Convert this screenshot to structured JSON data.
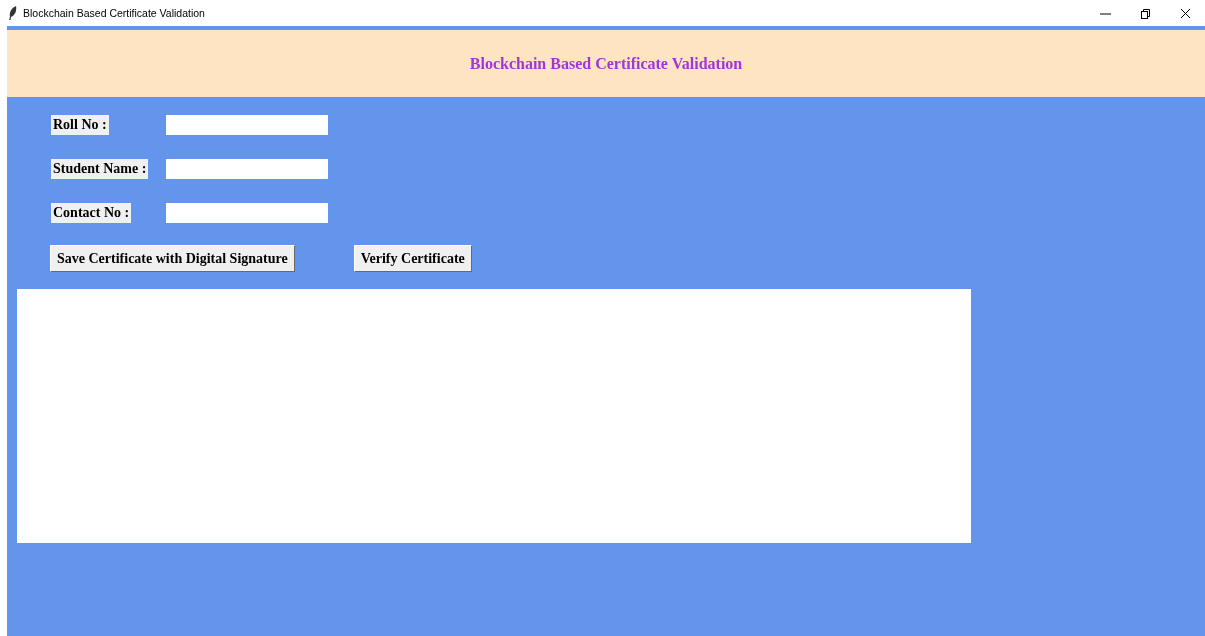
{
  "window": {
    "title": "Blockchain Based Certificate Validation"
  },
  "header": {
    "title": "Blockchain Based Certificate Validation"
  },
  "fields": [
    {
      "label": "Roll No :"
    },
    {
      "label": "Student Name :"
    },
    {
      "label": "Contact No :"
    }
  ],
  "buttons": [
    {
      "label": "Save Certificate with Digital Signature"
    },
    {
      "label": "Verify Certificate"
    }
  ]
}
